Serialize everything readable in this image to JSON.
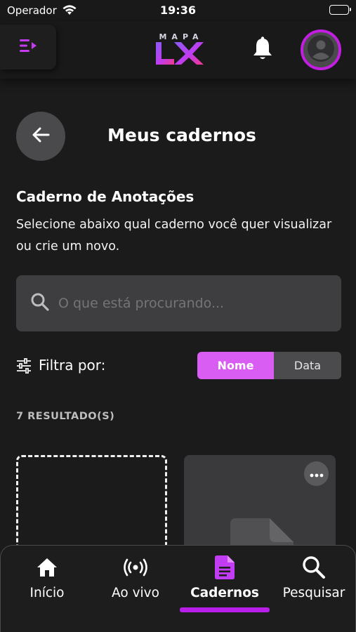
{
  "status_bar": {
    "carrier": "Operador",
    "time": "19:36"
  },
  "header": {
    "logo_top": "MAPA",
    "logo_bottom": "LX",
    "icons": [
      "menu-collapse-icon",
      "bell-icon",
      "avatar-icon"
    ]
  },
  "page": {
    "title": "Meus cadernos",
    "section_heading": "Caderno de Anotações",
    "section_description": "Selecione abaixo qual caderno você quer visualizar ou crie um novo."
  },
  "search": {
    "placeholder": "O que está procurando..."
  },
  "filter": {
    "label": "Filtra por:",
    "options": [
      "Nome",
      "Data"
    ],
    "selected": "Nome"
  },
  "results": {
    "count_label": "7 RESULTADO(S)"
  },
  "bottom_nav": {
    "items": [
      {
        "label": "Início",
        "icon": "home-icon"
      },
      {
        "label": "Ao vivo",
        "icon": "broadcast-icon"
      },
      {
        "label": "Cadernos",
        "icon": "notebook-icon"
      },
      {
        "label": "Pesquisar",
        "icon": "search-icon"
      }
    ],
    "active": "Cadernos"
  },
  "colors": {
    "accent": "#d95df2",
    "accent_dark": "#b81ee8",
    "background": "#1c1b1c",
    "surface": "#3e3d3f"
  }
}
